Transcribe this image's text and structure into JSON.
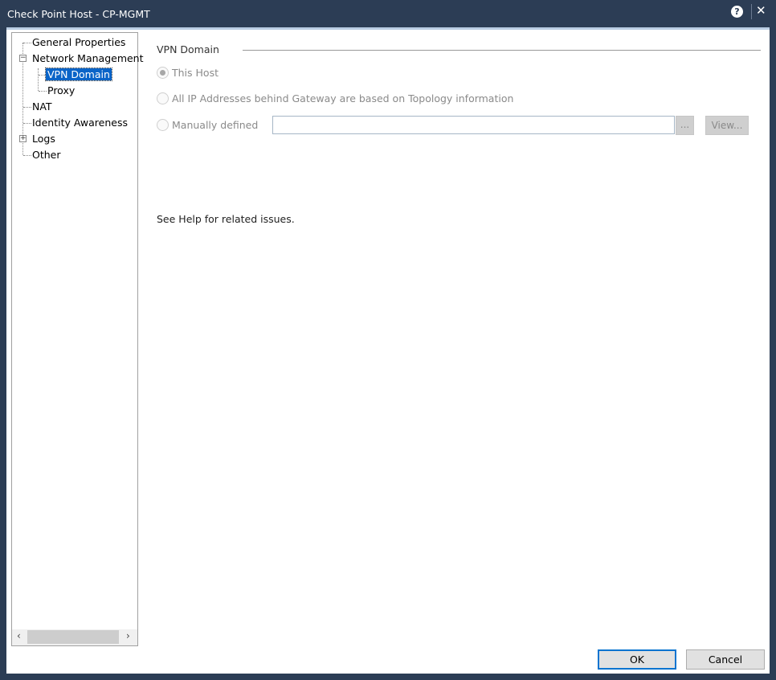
{
  "window": {
    "title": "Check Point Host - CP-MGMT",
    "help_icon": "?",
    "close_icon": "✕"
  },
  "tree": {
    "items": [
      {
        "label": "General Properties"
      },
      {
        "label": "Network Management",
        "expander": "−"
      },
      {
        "label": "VPN Domain"
      },
      {
        "label": "Proxy"
      },
      {
        "label": "NAT"
      },
      {
        "label": "Identity Awareness"
      },
      {
        "label": "Logs",
        "expander": "+"
      },
      {
        "label": "Other"
      }
    ],
    "scroll_left": "‹",
    "scroll_right": "›"
  },
  "main": {
    "section_title": "VPN Domain",
    "options": [
      {
        "label": "This Host",
        "checked": true
      },
      {
        "label": "All IP Addresses behind Gateway are based on Topology information",
        "checked": false
      },
      {
        "label": "Manually defined",
        "checked": false
      }
    ],
    "manual_value": "",
    "browse_label": "...",
    "view_label": "View...",
    "help_text": "See Help for related issues."
  },
  "footer": {
    "ok": "OK",
    "cancel": "Cancel"
  }
}
